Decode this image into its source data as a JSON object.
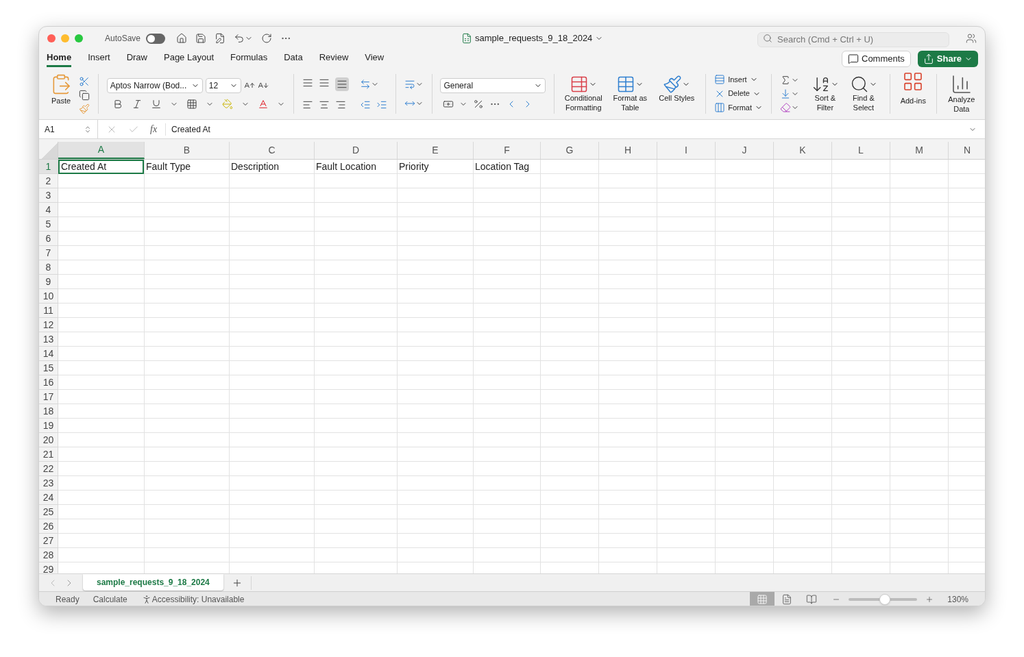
{
  "window": {
    "title": "sample_requests_9_18_2024"
  },
  "autosave": {
    "label": "AutoSave",
    "on": false
  },
  "search": {
    "placeholder": "Search (Cmd + Ctrl + U)"
  },
  "ribbon_tabs": [
    {
      "label": "Home",
      "selected": true
    },
    {
      "label": "Insert",
      "selected": false
    },
    {
      "label": "Draw",
      "selected": false
    },
    {
      "label": "Page Layout",
      "selected": false
    },
    {
      "label": "Formulas",
      "selected": false
    },
    {
      "label": "Data",
      "selected": false
    },
    {
      "label": "Review",
      "selected": false
    },
    {
      "label": "View",
      "selected": false
    }
  ],
  "comments_button": "Comments",
  "share_button": "Share",
  "ribbon": {
    "paste": "Paste",
    "font_name": "Aptos Narrow (Bod...",
    "font_size": "12",
    "number_format": "General",
    "styles": [
      {
        "label": "Conditional Formatting",
        "kind": "conditional"
      },
      {
        "label": "Format as Table",
        "kind": "table"
      },
      {
        "label": "Cell Styles",
        "kind": "styles"
      }
    ],
    "cells": [
      {
        "label": "Insert",
        "kind": "insert"
      },
      {
        "label": "Delete",
        "kind": "delete"
      },
      {
        "label": "Format",
        "kind": "format"
      }
    ],
    "editing": [
      {
        "label": "Sort & Filter",
        "kind": "sort"
      },
      {
        "label": "Find & Select",
        "kind": "find"
      }
    ],
    "addins": "Add-ins",
    "analyze": "Analyze Data"
  },
  "formula_bar": {
    "name_box": "A1",
    "function_label": "fx",
    "formula": "Created At"
  },
  "columns": [
    {
      "label": "A",
      "selected": true
    },
    {
      "label": "B",
      "selected": false
    },
    {
      "label": "C",
      "selected": false
    },
    {
      "label": "D",
      "selected": false
    },
    {
      "label": "E",
      "selected": false
    },
    {
      "label": "F",
      "selected": false
    },
    {
      "label": "G",
      "selected": false
    },
    {
      "label": "H",
      "selected": false
    },
    {
      "label": "I",
      "selected": false
    },
    {
      "label": "J",
      "selected": false
    },
    {
      "label": "K",
      "selected": false
    },
    {
      "label": "L",
      "selected": false
    },
    {
      "label": "M",
      "selected": false
    },
    {
      "label": "N",
      "selected": false
    }
  ],
  "rows": [
    {
      "label": "1",
      "selected": true,
      "cells": [
        "Created At",
        "Fault Type",
        "Description",
        "Fault Location",
        "Priority",
        "Location Tag"
      ]
    },
    {
      "label": "2",
      "selected": false
    },
    {
      "label": "3",
      "selected": false
    },
    {
      "label": "4",
      "selected": false
    },
    {
      "label": "5",
      "selected": false
    },
    {
      "label": "6",
      "selected": false
    },
    {
      "label": "7",
      "selected": false
    },
    {
      "label": "8",
      "selected": false
    },
    {
      "label": "9",
      "selected": false
    },
    {
      "label": "10",
      "selected": false
    },
    {
      "label": "11",
      "selected": false
    },
    {
      "label": "12",
      "selected": false
    },
    {
      "label": "13",
      "selected": false
    },
    {
      "label": "14",
      "selected": false
    },
    {
      "label": "15",
      "selected": false
    },
    {
      "label": "16",
      "selected": false
    },
    {
      "label": "17",
      "selected": false
    },
    {
      "label": "18",
      "selected": false
    },
    {
      "label": "19",
      "selected": false
    },
    {
      "label": "20",
      "selected": false
    },
    {
      "label": "21",
      "selected": false
    },
    {
      "label": "22",
      "selected": false
    },
    {
      "label": "23",
      "selected": false
    },
    {
      "label": "24",
      "selected": false
    },
    {
      "label": "25",
      "selected": false
    },
    {
      "label": "26",
      "selected": false
    },
    {
      "label": "27",
      "selected": false
    },
    {
      "label": "28",
      "selected": false
    },
    {
      "label": "29",
      "selected": false
    }
  ],
  "sheet_tabs": [
    {
      "label": "sample_requests_9_18_2024",
      "selected": true
    }
  ],
  "status_bar": {
    "items": [
      "Ready",
      "Calculate"
    ],
    "accessibility": "Accessibility: Unavailable",
    "views": [
      {
        "kind": "normal",
        "selected": true
      },
      {
        "kind": "page",
        "selected": false
      },
      {
        "kind": "break",
        "selected": false
      }
    ],
    "zoom": {
      "level": 0.53,
      "reading": "130%"
    }
  }
}
